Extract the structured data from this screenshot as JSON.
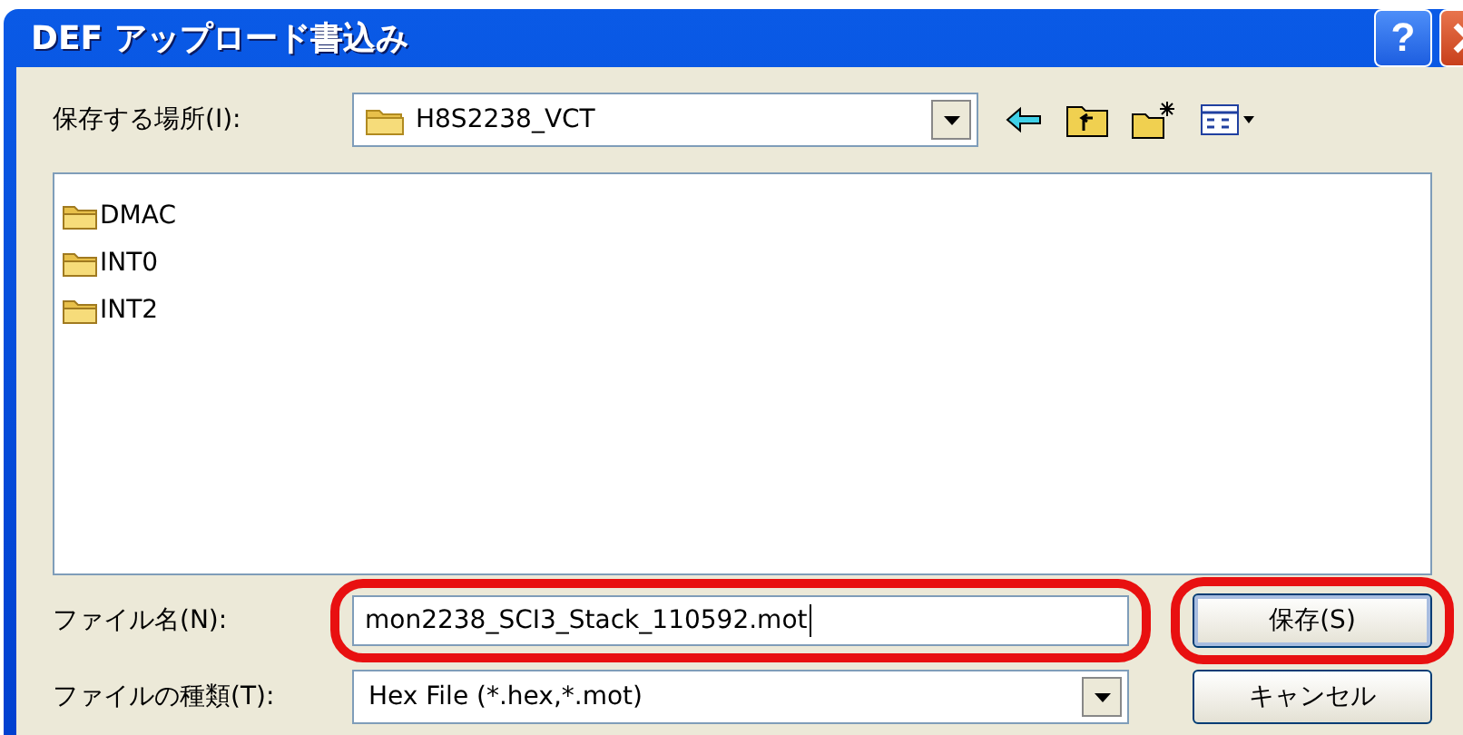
{
  "window": {
    "title": "DEF アップロード書込み",
    "title_buttons": [
      {
        "kind": "help",
        "label": "?"
      },
      {
        "kind": "close"
      }
    ]
  },
  "location": {
    "label": "保存する場所(I):",
    "value": "H8S2238_VCT"
  },
  "toolbar": [
    {
      "kind": "back"
    },
    {
      "kind": "up"
    },
    {
      "kind": "new-folder"
    },
    {
      "kind": "view"
    }
  ],
  "files": [
    {
      "name": "DMAC"
    },
    {
      "name": "INT0"
    },
    {
      "name": "INT2"
    }
  ],
  "file_name": {
    "label": "ファイル名(N):",
    "value": "mon2238_SCI3_Stack_110592.mot",
    "highlighted": true
  },
  "file_type": {
    "label": "ファイルの種類(T):",
    "value": "Hex File (*.hex,*.mot)"
  },
  "buttons": [
    {
      "label": "保存(S)",
      "highlighted": true,
      "default": true
    },
    {
      "label": "キャンセル",
      "highlighted": false,
      "default": false
    }
  ]
}
